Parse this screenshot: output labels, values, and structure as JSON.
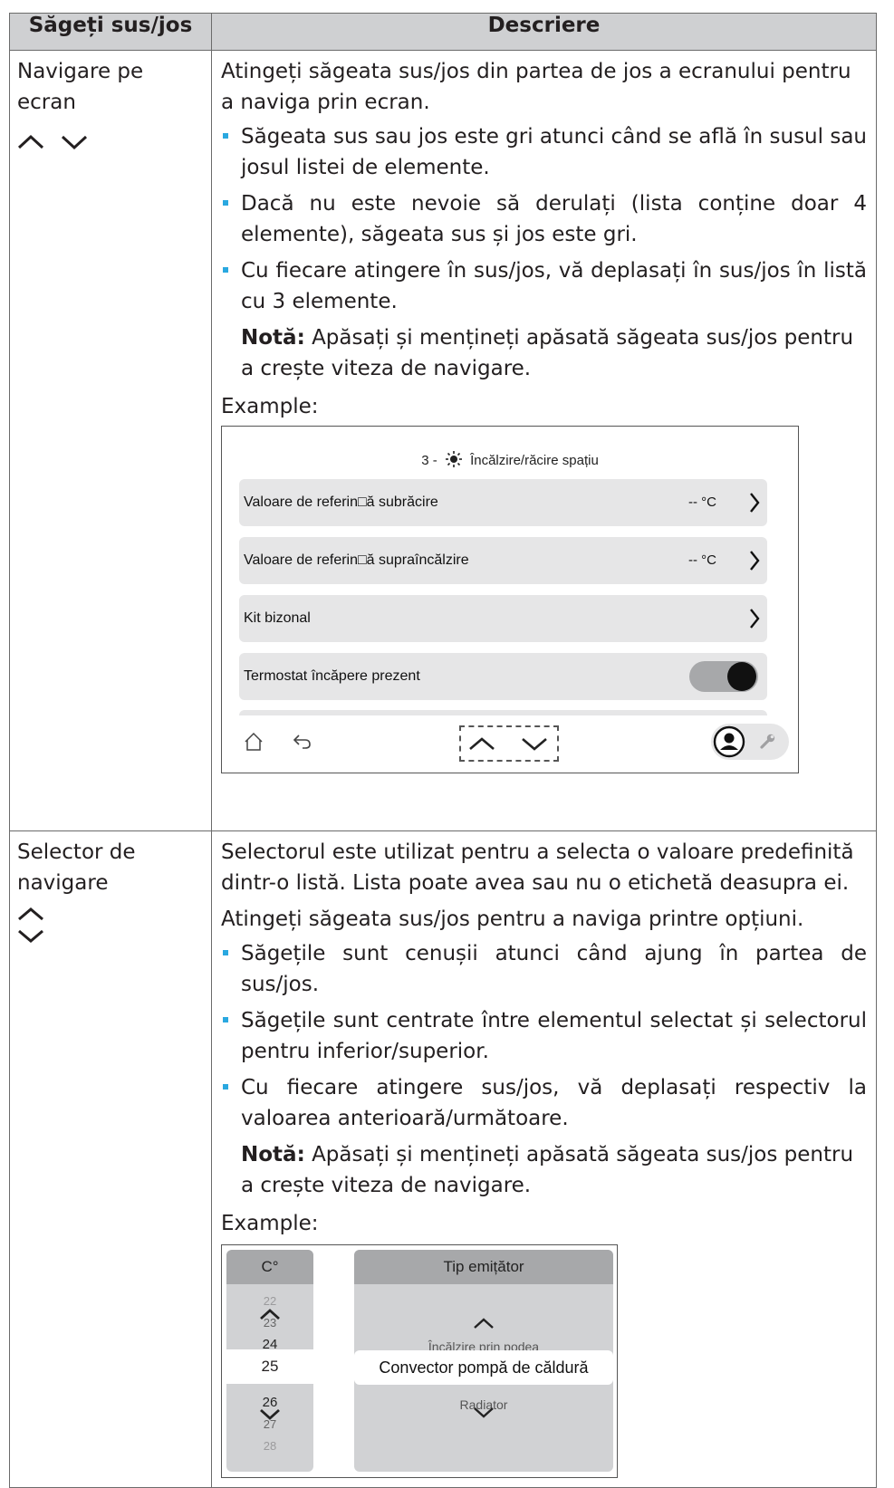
{
  "table": {
    "headers": [
      "Săgeți sus/jos",
      "Descriere"
    ],
    "rows": [
      {
        "label": "Navigare pe ecran",
        "intro": "Atingeți săgeata sus/jos din partea de jos a ecranului pentru a naviga prin ecran.",
        "bullets": [
          "Săgeata sus sau jos este gri atunci când se află în susul sau josul listei de elemente.",
          "Dacă nu este nevoie să derulați (lista conține doar 4 elemente), săgeata sus și jos este gri.",
          "Cu fiecare atingere în sus/jos, vă deplasați în sus/jos în listă cu 3 elemente."
        ],
        "note_label": "Notă:",
        "note_text": " Apăsați și mențineți apăsată săgeata sus/jos pentru a crește viteza de navigare.",
        "example_label": "Example:"
      },
      {
        "label": "Selector de navigare",
        "intro": "Selectorul este utilizat pentru a selecta o valoare predefinită dintr-o listă. Lista poate avea sau nu o etichetă deasupra ei.",
        "intro2": "Atingeți săgeata sus/jos pentru a naviga printre opțiuni.",
        "bullets": [
          "Săgețile sunt cenușii atunci când ajung în partea de sus/jos.",
          "Săgețile sunt centrate între elementul selectat și selectorul pentru inferior/superior.",
          "Cu fiecare atingere sus/jos, vă deplasați respectiv la valoarea anterioară/următoare."
        ],
        "note_label": "Notă:",
        "note_text": " Apăsați și mențineți apăsată săgeata sus/jos pentru a crește viteza de navigare.",
        "example_label": "Example:"
      }
    ]
  },
  "screen1": {
    "title": "3 - ☀️ Încălzire/răcire spațiu",
    "title_prefix": "3 -",
    "title_text": "Încălzire/răcire spațiu",
    "rows": [
      {
        "label": "Valoare de referin□ă subrăcire",
        "value": "-- °C"
      },
      {
        "label": "Valoare de referin□ă supraîncălzire",
        "value": "-- °C"
      },
      {
        "label": "Kit bizonal",
        "value": ""
      },
      {
        "label": "Termostat încăpere prezent",
        "value": ""
      }
    ],
    "toggle_on": true
  },
  "screen2": {
    "left_header": "C°",
    "numbers": [
      "22",
      "23",
      "24",
      "25",
      "26",
      "27",
      "28"
    ],
    "selected_number": "25",
    "right_header": "Tip emițător",
    "options_above": "Încălzire prin podea",
    "selected_option": "Convector pompă de căldură",
    "options_below": "Radiator"
  }
}
